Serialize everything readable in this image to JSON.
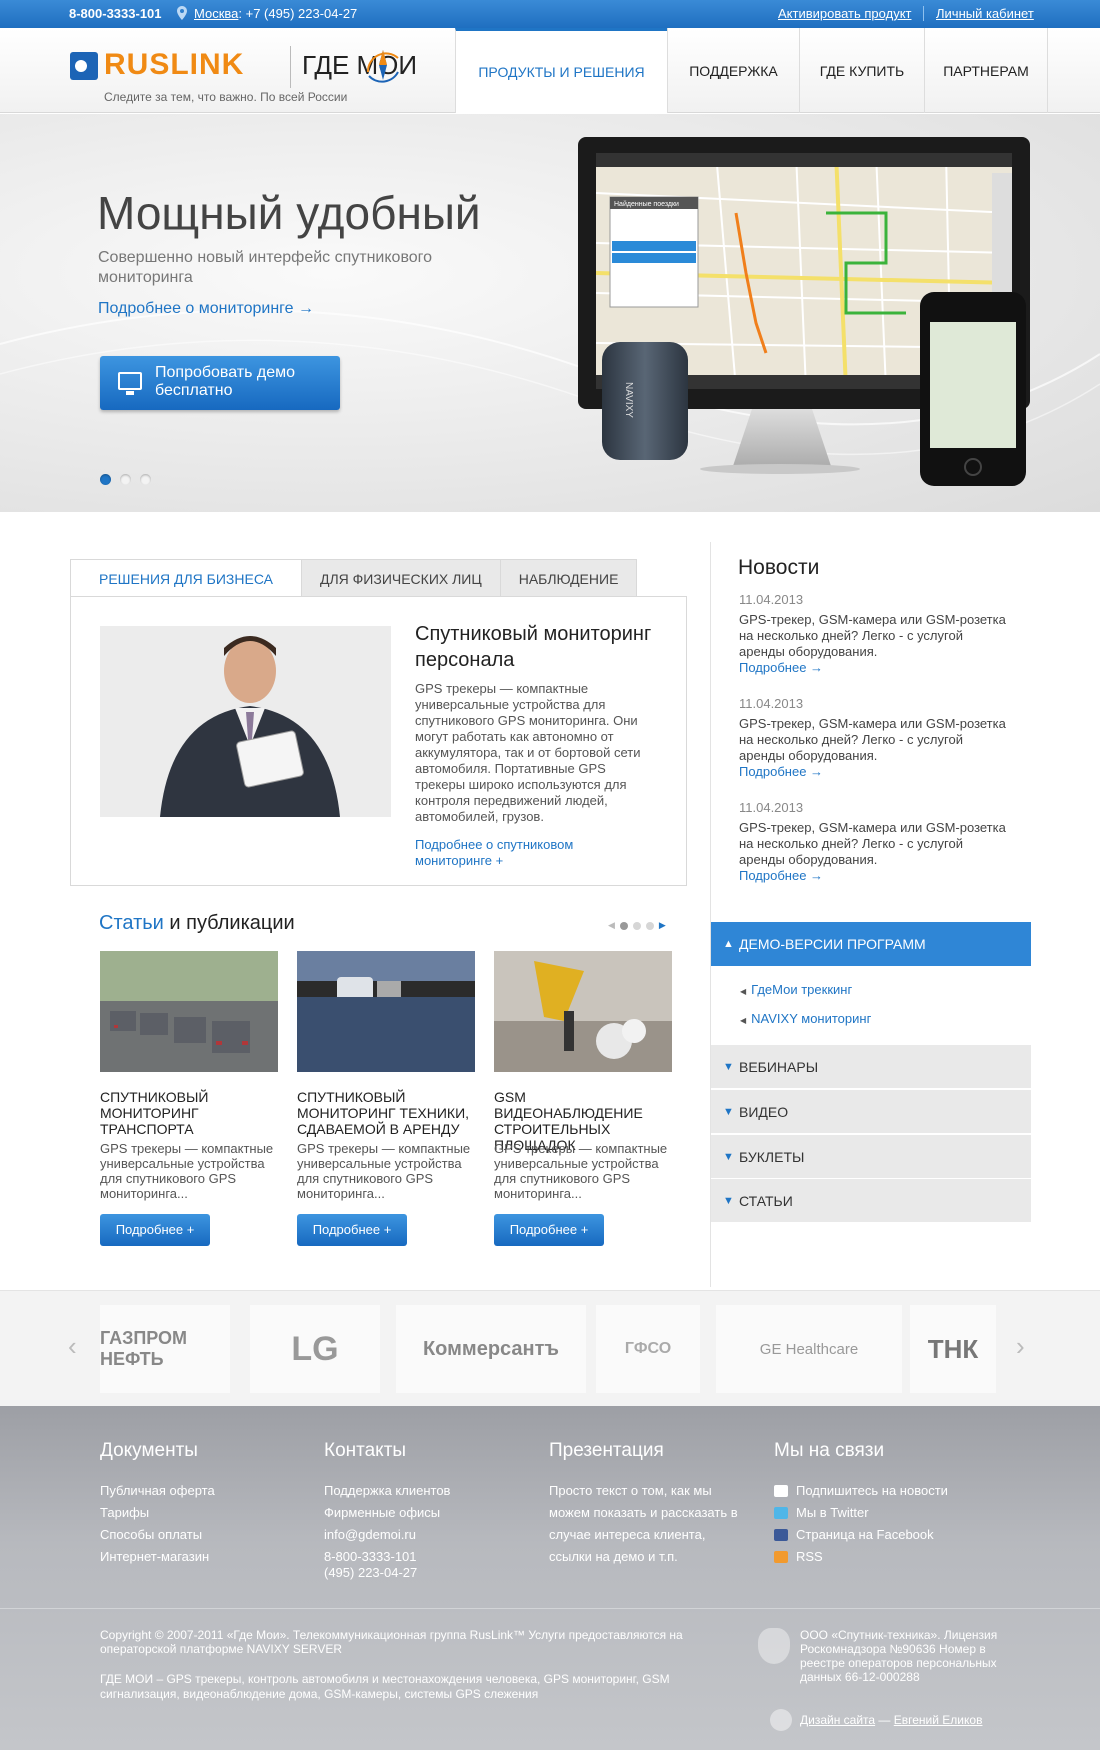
{
  "topbar": {
    "phone": "8-800-3333-101",
    "city": "Москва",
    "city_phone": ": +7 (495) 223-04-27",
    "activate": "Активировать продукт",
    "cabinet": "Личный кабинет"
  },
  "header": {
    "logo_left": "RUSLINK",
    "logo_right": "ГДЕ МОИ",
    "tagline": "Следите за тем, что важно. По всей России",
    "nav": [
      "ПРОДУКТЫ И РЕШЕНИЯ",
      "ПОДДЕРЖКА",
      "ГДЕ КУПИТЬ",
      "ПАРТНЕРАМ"
    ]
  },
  "hero": {
    "title": "Мощный удобный",
    "subtitle": "Совершенно новый интерфейс спутникового мониторинга",
    "link": "Подробнее о мониторинге →",
    "button": "Попробовать демо бесплатно",
    "tracker_label": "NAVIXY",
    "screen_panel_title": "Найденные поездки",
    "slides": 3,
    "active_slide": 1
  },
  "tabs": {
    "items": [
      "РЕШЕНИЯ ДЛЯ БИЗНЕСА",
      "ДЛЯ ФИЗИЧЕСКИХ ЛИЦ",
      "НАБЛЮДЕНИЕ"
    ],
    "panel": {
      "title": "Спутниковый мониторинг персонала",
      "text": "GPS трекеры — компактные универсальные устройства для спутникового GPS мониторинга. Они могут работать как автономно от аккумулятора, так и от бортовой сети автомобиля. Портативные GPS трекеры широко используются для контроля передвижений людей, автомобилей, грузов.",
      "link": "Подробнее о спутниковом мониторинге +"
    }
  },
  "articles": {
    "title_blue": "Статьи",
    "title_rest": " и публикации",
    "items": [
      {
        "title": "СПУТНИКОВЫЙ МОНИТОРИНГ ТРАНСПОРТА",
        "desc": "GPS трекеры — компактные универсальные устройства для спутникового GPS мониторинга...",
        "button": "Подробнее +"
      },
      {
        "title": "СПУТНИКОВЫЙ МОНИТОРИНГ ТЕХНИКИ, СДАВАЕМОЙ В АРЕНДУ",
        "desc": "GPS трекеры — компактные универсальные устройства для спутникового GPS мониторинга...",
        "button": "Подробнее +"
      },
      {
        "title": "GSM ВИДЕОНАБЛЮДЕНИЕ СТРОИТЕЛЬНЫХ ПЛОЩАДОК",
        "desc": "GPS трекеры — компактные универсальные устройства для спутникового GPS мониторинга...",
        "button": "Подробнее +"
      }
    ]
  },
  "news": {
    "title": "Новости",
    "items": [
      {
        "date": "11.04.2013",
        "text": "GPS-трекер, GSM-камера или GSM-розетка на несколько дней? Легко - с услугой аренды оборудования.",
        "more": "Подробнее →"
      },
      {
        "date": "11.04.2013",
        "text": "GPS-трекер, GSM-камера или GSM-розетка на несколько дней? Легко - с услугой аренды оборудования.",
        "more": "Подробнее →"
      },
      {
        "date": "11.04.2013",
        "text": "GPS-трекер, GSM-камера или GSM-розетка на несколько дней? Легко - с услугой аренды оборудования.",
        "more": "Подробнее →"
      }
    ]
  },
  "accordion": {
    "open_title": "ДЕМО-ВЕРСИИ ПРОГРАММ",
    "open_items": [
      "ГдеМои треккинг",
      "NAVIXY мониторинг"
    ],
    "closed": [
      "ВЕБИНАРЫ",
      "ВИДЕО",
      "БУКЛЕТЫ",
      "СТАТЬИ"
    ]
  },
  "partners": [
    "ГАЗПРОМ НЕФТЬ",
    "LG",
    "Коммерсантъ",
    "ГФСО",
    "GE Healthcare",
    "ТНК"
  ],
  "footer": {
    "docs": {
      "title": "Документы",
      "links": [
        "Публичная оферта",
        "Тарифы",
        "Способы оплаты",
        "Интернет-магазин"
      ]
    },
    "contacts": {
      "title": "Контакты",
      "links": [
        "Поддержка клиентов",
        "Фирменные офисы",
        "info@gdemoi.ru",
        "8-800-3333-101",
        "(495) 223-04-27"
      ]
    },
    "presentation": {
      "title": "Презентация",
      "text": "Просто текст о том, как мы можем показать и рассказать в случае интереса клиента, ссылки на демо и т.п."
    },
    "social": {
      "title": "Мы на связи",
      "links": [
        "Подпишитесь на новости",
        "Мы в Twitter",
        "Страница на Facebook",
        "RSS"
      ]
    },
    "copyright": "Copyright © 2007-2011 «Где Мои». Телекоммуникационная группа RusLink™ Услуги предоставляются на операторской платформе NAVIXY SERVER",
    "seo": "ГДЕ МОИ – GPS трекеры, контроль автомобиля и местонахождения человека, GPS мониторинг, GSM сигнализация, видеонаблюдение дома, GSM-камеры, системы GPS слежения",
    "legal": "ООО «Спутник-техника». Лицензия Роскомнадзора №90636 Номер в реестре операторов персональных данных 66-12-000288",
    "design_label": "Дизайн сайта",
    "design_sep": " — ",
    "designer": "Евгений Еликов"
  },
  "colors": {
    "accent": "#1f75c5",
    "topbar": "#2a7cca",
    "footer": "#b0b2b7"
  }
}
